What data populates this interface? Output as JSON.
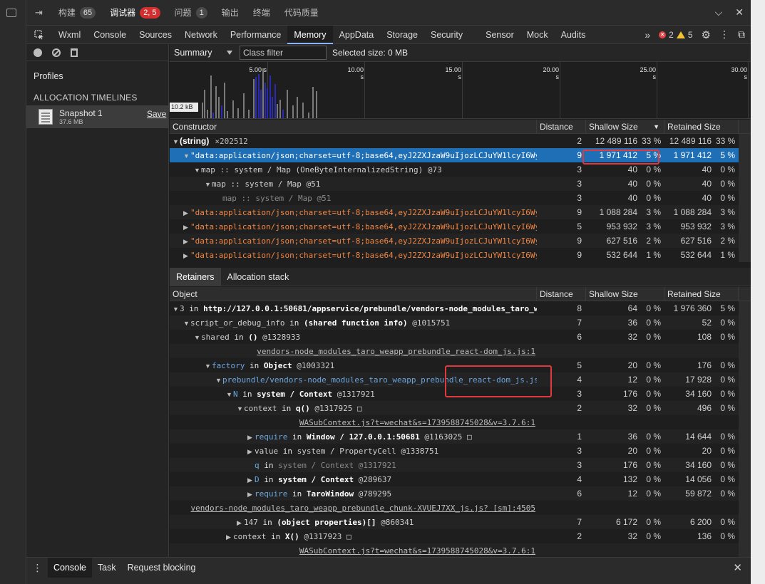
{
  "top_tabs": [
    {
      "label": "构建",
      "badge": "65",
      "badge_red": false
    },
    {
      "label": "调试器",
      "badge": "2, 5",
      "badge_red": true,
      "active": true
    },
    {
      "label": "问题",
      "badge": "1",
      "badge_red": false
    },
    {
      "label": "输出"
    },
    {
      "label": "终端"
    },
    {
      "label": "代码质量"
    }
  ],
  "panel_tabs": [
    "Wxml",
    "Console",
    "Sources",
    "Network",
    "Performance",
    "Memory",
    "AppData",
    "Storage",
    "Security",
    "Sensor",
    "Mock",
    "Audits"
  ],
  "active_panel": "Memory",
  "more_tabs": "»",
  "counts": {
    "errors": "2",
    "warnings": "5"
  },
  "sidebar": {
    "profiles_title": "Profiles",
    "alloc_header": "ALLOCATION TIMELINES",
    "snapshot": {
      "name": "Snapshot 1",
      "size": "37.6 MB",
      "save": "Save"
    }
  },
  "toolbar": {
    "view": "Summary",
    "class_filter_placeholder": "Class filter",
    "selected_size": "Selected size: 0 MB"
  },
  "timeline": {
    "ticks": [
      "5.00 s",
      "10.00 s",
      "15.00 s",
      "20.00 s",
      "25.00 s",
      "30.00 s"
    ],
    "scale_label": "10.2 kB"
  },
  "constructor_grid": {
    "headers": {
      "name": "Constructor",
      "distance": "Distance",
      "shallow": "Shallow Size",
      "retained": "Retained Size"
    },
    "rows": [
      {
        "indent": 0,
        "arrow": "▼",
        "name": "(string)",
        "extra": "×202512",
        "kind": "plain",
        "distance": "2",
        "shallow": "12 489 116",
        "shallow_pct": "33 %",
        "retained": "12 489 116",
        "retained_pct": "33 %"
      },
      {
        "indent": 1,
        "arrow": "▼",
        "name": "\"data:application/json;charset=utf-8;base64,eyJ2ZXJzaW9uIjozLCJuYW1lcyI6Wy",
        "kind": "str",
        "selected": true,
        "distance": "9",
        "shallow": "1 971 412",
        "shallow_pct": "5 %",
        "retained": "1 971 412",
        "retained_pct": "5 %"
      },
      {
        "indent": 2,
        "arrow": "▼",
        "name": "map :: system / Map (OneByteInternalizedString) @73",
        "kind": "mono",
        "distance": "3",
        "shallow": "40",
        "shallow_pct": "0 %",
        "retained": "40",
        "retained_pct": "0 %"
      },
      {
        "indent": 3,
        "arrow": "▼",
        "name": "map :: system / Map @51",
        "kind": "mono",
        "distance": "3",
        "shallow": "40",
        "shallow_pct": "0 %",
        "retained": "40",
        "retained_pct": "0 %"
      },
      {
        "indent": 4,
        "arrow": "",
        "name": "map :: system / Map @51",
        "kind": "dim",
        "distance": "3",
        "shallow": "40",
        "shallow_pct": "0 %",
        "retained": "40",
        "retained_pct": "0 %"
      },
      {
        "indent": 1,
        "arrow": "▶",
        "name": "\"data:application/json;charset=utf-8;base64,eyJ2ZXJzaW9uIjozLCJuYW1lcyI6Wy",
        "kind": "str",
        "distance": "9",
        "shallow": "1 088 284",
        "shallow_pct": "3 %",
        "retained": "1 088 284",
        "retained_pct": "3 %"
      },
      {
        "indent": 1,
        "arrow": "▶",
        "name": "\"data:application/json;charset=utf-8;base64,eyJ2ZXJzaW9uIjozLCJuYW1lcyI6Wy",
        "kind": "str",
        "distance": "5",
        "shallow": "953 932",
        "shallow_pct": "3 %",
        "retained": "953 932",
        "retained_pct": "3 %"
      },
      {
        "indent": 1,
        "arrow": "▶",
        "name": "\"data:application/json;charset=utf-8;base64,eyJ2ZXJzaW9uIjozLCJuYW1lcyI6Wy",
        "kind": "str",
        "distance": "9",
        "shallow": "627 516",
        "shallow_pct": "2 %",
        "retained": "627 516",
        "retained_pct": "2 %"
      },
      {
        "indent": 1,
        "arrow": "▶",
        "name": "\"data:application/json;charset=utf-8;base64,eyJ2ZXJzaW9uIjozLCJuYW1lcyI6Wy",
        "kind": "str",
        "distance": "9",
        "shallow": "532 644",
        "shallow_pct": "1 %",
        "retained": "532 644",
        "retained_pct": "1 %"
      }
    ]
  },
  "retainer_tabs": [
    "Retainers",
    "Allocation stack"
  ],
  "retainer_grid": {
    "headers": {
      "name": "Object",
      "distance": "Distance",
      "shallow": "Shallow Size",
      "retained": "Retained Size"
    },
    "rows": [
      {
        "indent": 0,
        "arrow": "▼",
        "parts": [
          [
            "plain",
            "3"
          ],
          [
            "kw",
            " in "
          ],
          [
            "bold",
            "http://127.0.0.1:50681/appservice/prebundle/vendors-node_modules_taro_w"
          ]
        ],
        "distance": "8",
        "shallow": "64",
        "shallow_pct": "0 %",
        "retained": "1 976 360",
        "retained_pct": "5 %"
      },
      {
        "indent": 1,
        "arrow": "▼",
        "parts": [
          [
            "plain",
            "script_or_debug_info"
          ],
          [
            "kw",
            " in "
          ],
          [
            "bold",
            "(shared function info)"
          ],
          [
            "plain",
            " @1015751"
          ]
        ],
        "distance": "7",
        "shallow": "36",
        "shallow_pct": "0 %",
        "retained": "52",
        "retained_pct": "0 %"
      },
      {
        "indent": 2,
        "arrow": "▼",
        "parts": [
          [
            "plain",
            "shared"
          ],
          [
            "kw",
            " in "
          ],
          [
            "bold",
            "()"
          ],
          [
            "plain",
            " @1328933"
          ]
        ],
        "distance": "6",
        "shallow": "32",
        "shallow_pct": "0 %",
        "retained": "108",
        "retained_pct": "0 %"
      },
      {
        "indent": 0,
        "arrow": "",
        "link_row": true,
        "link_right": 513,
        "parts": [
          [
            "link",
            "vendors-node_modules_taro_weapp_prebundle_react-dom_js.js:1"
          ]
        ],
        "distance": "",
        "shallow": "",
        "shallow_pct": "",
        "retained": "",
        "retained_pct": ""
      },
      {
        "indent": 3,
        "arrow": "▼",
        "parts": [
          [
            "blue",
            "factory"
          ],
          [
            "kw",
            " in "
          ],
          [
            "bold",
            "Object"
          ],
          [
            "plain",
            " @1003321"
          ]
        ],
        "distance": "5",
        "shallow": "20",
        "shallow_pct": "0 %",
        "retained": "176",
        "retained_pct": "0 %"
      },
      {
        "indent": 4,
        "arrow": "▼",
        "parts": [
          [
            "blue",
            "prebundle/vendors-node_modules_taro_weapp_prebundle_react-dom_js.js"
          ]
        ],
        "distance": "4",
        "shallow": "12",
        "shallow_pct": "0 %",
        "retained": "17 928",
        "retained_pct": "0 %"
      },
      {
        "indent": 5,
        "arrow": "▼",
        "parts": [
          [
            "blue",
            "N"
          ],
          [
            "kw",
            " in "
          ],
          [
            "bold",
            "system / Context"
          ],
          [
            "plain",
            " @1317921"
          ]
        ],
        "distance": "3",
        "shallow": "176",
        "shallow_pct": "0 %",
        "retained": "34 160",
        "retained_pct": "0 %"
      },
      {
        "indent": 6,
        "arrow": "▼",
        "parts": [
          [
            "plain",
            "context"
          ],
          [
            "kw",
            " in "
          ],
          [
            "bold",
            "q()"
          ],
          [
            "plain",
            " @1317925 □"
          ]
        ],
        "distance": "2",
        "shallow": "32",
        "shallow_pct": "0 %",
        "retained": "496",
        "retained_pct": "0 %"
      },
      {
        "indent": 0,
        "arrow": "",
        "link_row": true,
        "link_right": 513,
        "parts": [
          [
            "link",
            "WASubContext.js?t=wechat&s=1739588745028&v=3.7.6:1"
          ]
        ],
        "distance": "",
        "shallow": "",
        "shallow_pct": "",
        "retained": "",
        "retained_pct": ""
      },
      {
        "indent": 7,
        "arrow": "▶",
        "parts": [
          [
            "blue",
            "require"
          ],
          [
            "kw",
            " in "
          ],
          [
            "bold",
            "Window / 127.0.0.1:50681"
          ],
          [
            "plain",
            " @1163025 □"
          ]
        ],
        "distance": "1",
        "shallow": "36",
        "shallow_pct": "0 %",
        "retained": "14 644",
        "retained_pct": "0 %"
      },
      {
        "indent": 7,
        "arrow": "▶",
        "parts": [
          [
            "plain",
            "value"
          ],
          [
            "kw",
            " in "
          ],
          [
            "plain",
            "system / PropertyCell @1338751"
          ]
        ],
        "distance": "3",
        "shallow": "20",
        "shallow_pct": "0 %",
        "retained": "20",
        "retained_pct": "0 %"
      },
      {
        "indent": 7,
        "arrow": "",
        "parts": [
          [
            "blue",
            "q"
          ],
          [
            "kw",
            " in "
          ],
          [
            "plain",
            "system / Context @1317921"
          ]
        ],
        "dimmed": true,
        "distance": "3",
        "shallow": "176",
        "shallow_pct": "0 %",
        "retained": "34 160",
        "retained_pct": "0 %"
      },
      {
        "indent": 7,
        "arrow": "▶",
        "parts": [
          [
            "blue",
            "D"
          ],
          [
            "kw",
            " in "
          ],
          [
            "bold",
            "system / Context"
          ],
          [
            "plain",
            " @289637"
          ]
        ],
        "distance": "4",
        "shallow": "132",
        "shallow_pct": "0 %",
        "retained": "14 056",
        "retained_pct": "0 %"
      },
      {
        "indent": 7,
        "arrow": "▶",
        "parts": [
          [
            "blue",
            "require"
          ],
          [
            "kw",
            " in "
          ],
          [
            "bold",
            "TaroWindow"
          ],
          [
            "plain",
            " @789295"
          ]
        ],
        "distance": "6",
        "shallow": "12",
        "shallow_pct": "0 %",
        "retained": "59 872",
        "retained_pct": "0 %"
      },
      {
        "indent": 0,
        "arrow": "",
        "link_row": true,
        "link_right": 513,
        "parts": [
          [
            "link",
            "vendors-node_modules_taro_weapp_prebundle_chunk-XVUEJ7XX_js.js? [sm]:4505"
          ]
        ],
        "distance": "",
        "shallow": "",
        "shallow_pct": "",
        "retained": "",
        "retained_pct": ""
      },
      {
        "indent": 6,
        "arrow": "▶",
        "parts": [
          [
            "plain",
            "147"
          ],
          [
            "kw",
            " in "
          ],
          [
            "bold",
            "(object properties)[]"
          ],
          [
            "plain",
            " @860341"
          ]
        ],
        "distance": "7",
        "shallow": "6 172",
        "shallow_pct": "0 %",
        "retained": "6 200",
        "retained_pct": "0 %"
      },
      {
        "indent": 5,
        "arrow": "▶",
        "parts": [
          [
            "plain",
            "context"
          ],
          [
            "kw",
            " in "
          ],
          [
            "bold",
            "X()"
          ],
          [
            "plain",
            " @1317923 □"
          ]
        ],
        "distance": "2",
        "shallow": "32",
        "shallow_pct": "0 %",
        "retained": "136",
        "retained_pct": "0 %"
      },
      {
        "indent": 0,
        "arrow": "",
        "link_row": true,
        "link_right": 513,
        "parts": [
          [
            "link",
            "WASubContext.js?t=wechat&s=1739588745028&v=3.7.6:1"
          ]
        ],
        "distance": "",
        "shallow": "",
        "shallow_pct": "",
        "retained": "",
        "retained_pct": ""
      }
    ]
  },
  "drawer_tabs": [
    "Console",
    "Task",
    "Request blocking"
  ],
  "colors": {
    "accent": "#8ab4f8",
    "selection": "#1f6fb7",
    "string": "#ef8745",
    "highlight": "#e0393e"
  }
}
